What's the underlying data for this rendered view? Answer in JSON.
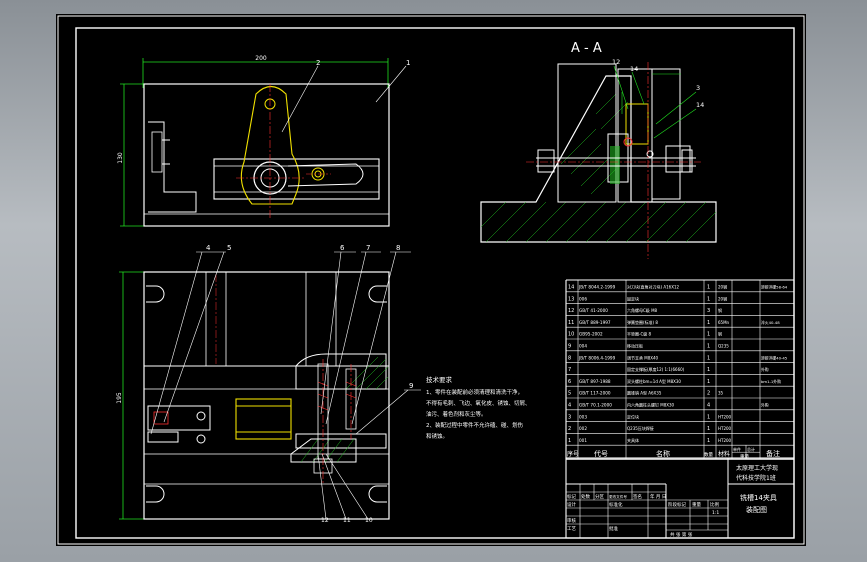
{
  "section_title": "A - A",
  "balloons": {
    "top_view": [
      "2",
      "1"
    ],
    "front_view_top": [
      "4",
      "5",
      "6",
      "7",
      "8"
    ],
    "front_view_right": "9",
    "front_view_bottom": [
      "12",
      "11",
      "10"
    ],
    "section_view": [
      "12",
      "14",
      "3",
      "14"
    ]
  },
  "dimensions": {
    "top_width": "200",
    "top_height": "130",
    "front_height": "195"
  },
  "tech_requirements": {
    "title": "技术要求",
    "lines": [
      "1、零件在装配前必须清理和清洗干净，",
      "不得有毛刺、飞边、氧化皮、锈蚀、切屑、",
      "油污、着色剂和灰尘等。",
      "2、装配过程中零件不允许磕、碰、划伤",
      "和锈蚀。"
    ]
  },
  "bom": {
    "rows": [
      {
        "no": "14",
        "code": "JB/T 8044.2-1999",
        "name": "对刀块(直角对刀块) A16X12",
        "qty": "1",
        "mat": "20钢",
        "note": "渗碳淬硬58-64"
      },
      {
        "no": "13",
        "code": "006",
        "name": "固定块",
        "qty": "1",
        "mat": "20钢",
        "note": ""
      },
      {
        "no": "12",
        "code": "GB/T 41-2000",
        "name": "六角螺母C级 M8",
        "qty": "3",
        "mat": "钢",
        "note": ""
      },
      {
        "no": "11",
        "code": "GB/T 889-1997",
        "name": "弹簧垫圈(标准) 8",
        "qty": "1",
        "mat": "65Mn",
        "note": "淬火40-48"
      },
      {
        "no": "10",
        "code": "GB95-2002",
        "name": "平垫圈-C级 8",
        "qty": "1",
        "mat": "钢",
        "note": ""
      },
      {
        "no": "9",
        "code": "004",
        "name": "移动压板",
        "qty": "1",
        "mat": "Q235",
        "note": ""
      },
      {
        "no": "8",
        "code": "JB/T 8006.4-1999",
        "name": "调节支承 M8X40",
        "qty": "1",
        "mat": "",
        "note": "渗碳淬硬40-45"
      },
      {
        "no": "7",
        "code": "",
        "name": "固定支撑板(厚度12) 1:1(6660)",
        "qty": "1",
        "mat": "",
        "note": "外购"
      },
      {
        "no": "6",
        "code": "GB/T 897-1988",
        "name": "双头螺柱bm=1d A型 M8X30",
        "qty": "1",
        "mat": "",
        "note": "bm1-1外购"
      },
      {
        "no": "5",
        "code": "GB/T 117-2000",
        "name": "圆锥销 A型 A6X35",
        "qty": "2",
        "mat": "35",
        "note": ""
      },
      {
        "no": "4",
        "code": "GB/T 70.1-2000",
        "name": "内六角圆柱头螺钉 M8X30",
        "qty": "4",
        "mat": "",
        "note": "外购"
      },
      {
        "no": "3",
        "code": "003",
        "name": "定位块",
        "qty": "1",
        "mat": "HT200",
        "note": ""
      },
      {
        "no": "2",
        "code": "002",
        "name": "Q235压块焊接",
        "qty": "1",
        "mat": "HT200",
        "note": ""
      },
      {
        "no": "1",
        "code": "001",
        "name": "夹具体",
        "qty": "1",
        "mat": "HT200",
        "note": ""
      }
    ],
    "header": {
      "no": "序号",
      "code": "代号",
      "name": "名称",
      "qty": "数量",
      "mat": "材料",
      "unit_weight": "单件",
      "total_weight": "总计",
      "weight": "重量",
      "note": "备注"
    }
  },
  "title_block": {
    "school_line1": "太原理工大学现",
    "school_line2": "代科技学院1班",
    "drawing_name_line1": "铣槽14夹具",
    "drawing_name_line2": "装配图",
    "scale": "1:1",
    "labels": {
      "mark": "标记",
      "count": "处数",
      "zone": "分区",
      "change_no": "更改文件号",
      "sign": "签名",
      "date": "年 月 日",
      "design": "设计",
      "standard": "标准化",
      "stage_mark": "阶段标记",
      "weight": "重量",
      "ratio": "比例",
      "review": "审核",
      "process": "工艺",
      "approve": "批准",
      "sheets": "共 张 第 张"
    }
  },
  "colors": {
    "outline": "#ffffff",
    "thin": "#20e020",
    "center": "#ff3030",
    "yellow": "#f0e000",
    "hatch": "#20c020",
    "leader": "#ffffff"
  }
}
